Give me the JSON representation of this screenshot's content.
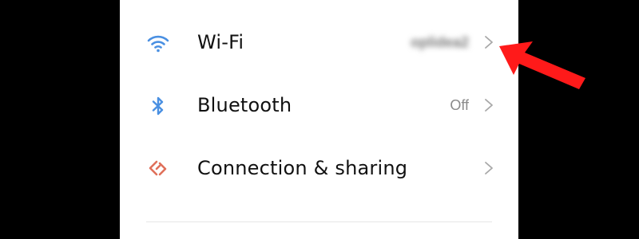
{
  "settings": {
    "items": [
      {
        "label": "Wi-Fi",
        "value": "oplidea2",
        "icon": "wifi-icon",
        "icon_color": "#4a90e2"
      },
      {
        "label": "Bluetooth",
        "value": "Off",
        "icon": "bluetooth-icon",
        "icon_color": "#4a90e2"
      },
      {
        "label": "Connection & sharing",
        "value": "",
        "icon": "connection-sharing-icon",
        "icon_color": "#e0705a"
      }
    ]
  },
  "annotation": {
    "arrow_color": "#ff1a1a",
    "arrow_target": "wifi-chevron"
  }
}
